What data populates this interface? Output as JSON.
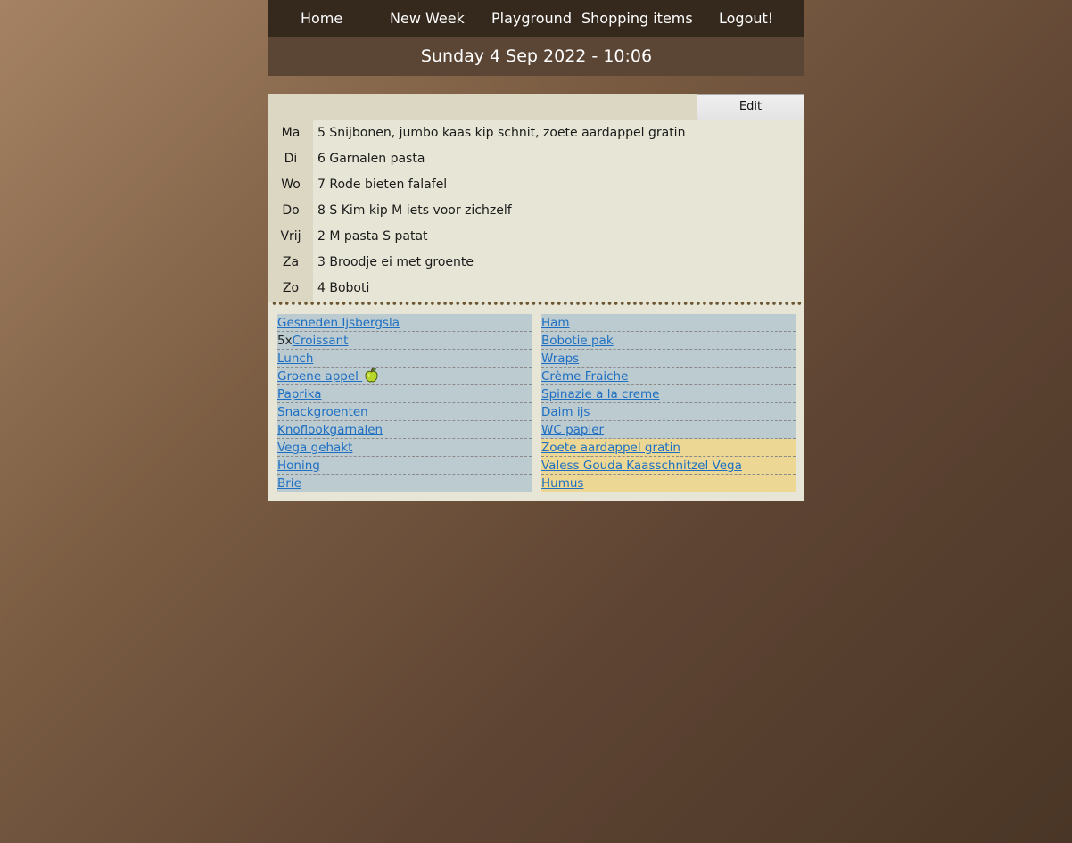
{
  "nav": {
    "home": "Home",
    "new_week": "New Week",
    "playground": "Playground",
    "shopping_items": "Shopping items",
    "logout": "Logout!"
  },
  "date_bar": "Sunday 4 Sep 2022 - 10:06",
  "edit_label": "Edit",
  "week": [
    {
      "day": "Ma",
      "meal": "5 Snijbonen, jumbo kaas kip schnit, zoete aardappel gratin"
    },
    {
      "day": "Di",
      "meal": "6 Garnalen pasta"
    },
    {
      "day": "Wo",
      "meal": "7 Rode bieten falafel"
    },
    {
      "day": "Do",
      "meal": "8 S Kim kip M iets voor zichzelf"
    },
    {
      "day": "Vrij",
      "meal": "2 M pasta S patat"
    },
    {
      "day": "Za",
      "meal": "3 Broodje ei met groente"
    },
    {
      "day": "Zo",
      "meal": "4 Boboti"
    }
  ],
  "shopping": {
    "left": [
      {
        "qty": "",
        "name": "Gesneden Ijsbergsla"
      },
      {
        "qty": "5x",
        "name": "Croissant"
      },
      {
        "qty": "",
        "name": "Lunch"
      },
      {
        "qty": "",
        "name": "Groene appel",
        "icon": "green-apple-icon"
      },
      {
        "qty": "",
        "name": "Paprika"
      },
      {
        "qty": "",
        "name": "Snackgroenten"
      },
      {
        "qty": "",
        "name": "Knoflookgarnalen"
      },
      {
        "qty": "",
        "name": "Vega gehakt"
      },
      {
        "qty": "",
        "name": "Honing"
      },
      {
        "qty": "",
        "name": "Brie"
      }
    ],
    "right": [
      {
        "name": "Ham",
        "highlight": false
      },
      {
        "name": "Bobotie pak",
        "highlight": false
      },
      {
        "name": "Wraps",
        "highlight": false
      },
      {
        "name": "Crème Fraiche",
        "highlight": false
      },
      {
        "name": "Spinazie a la creme",
        "highlight": false
      },
      {
        "name": "Daim ijs",
        "highlight": false
      },
      {
        "name": "WC papier",
        "highlight": false
      },
      {
        "name": "Zoete aardappel gratin",
        "highlight": true
      },
      {
        "name": "Valess Gouda Kaasschnitzel Vega",
        "highlight": true
      },
      {
        "name": "Humus",
        "highlight": true
      }
    ]
  },
  "colors": {
    "nav_bg": "#35291e",
    "date_bg": "#5b4535",
    "panel_bg": "#e7e6d6",
    "item_bg": "#bccbd0",
    "item_highlight_bg": "#ecd894",
    "link": "#1e6fc2"
  }
}
